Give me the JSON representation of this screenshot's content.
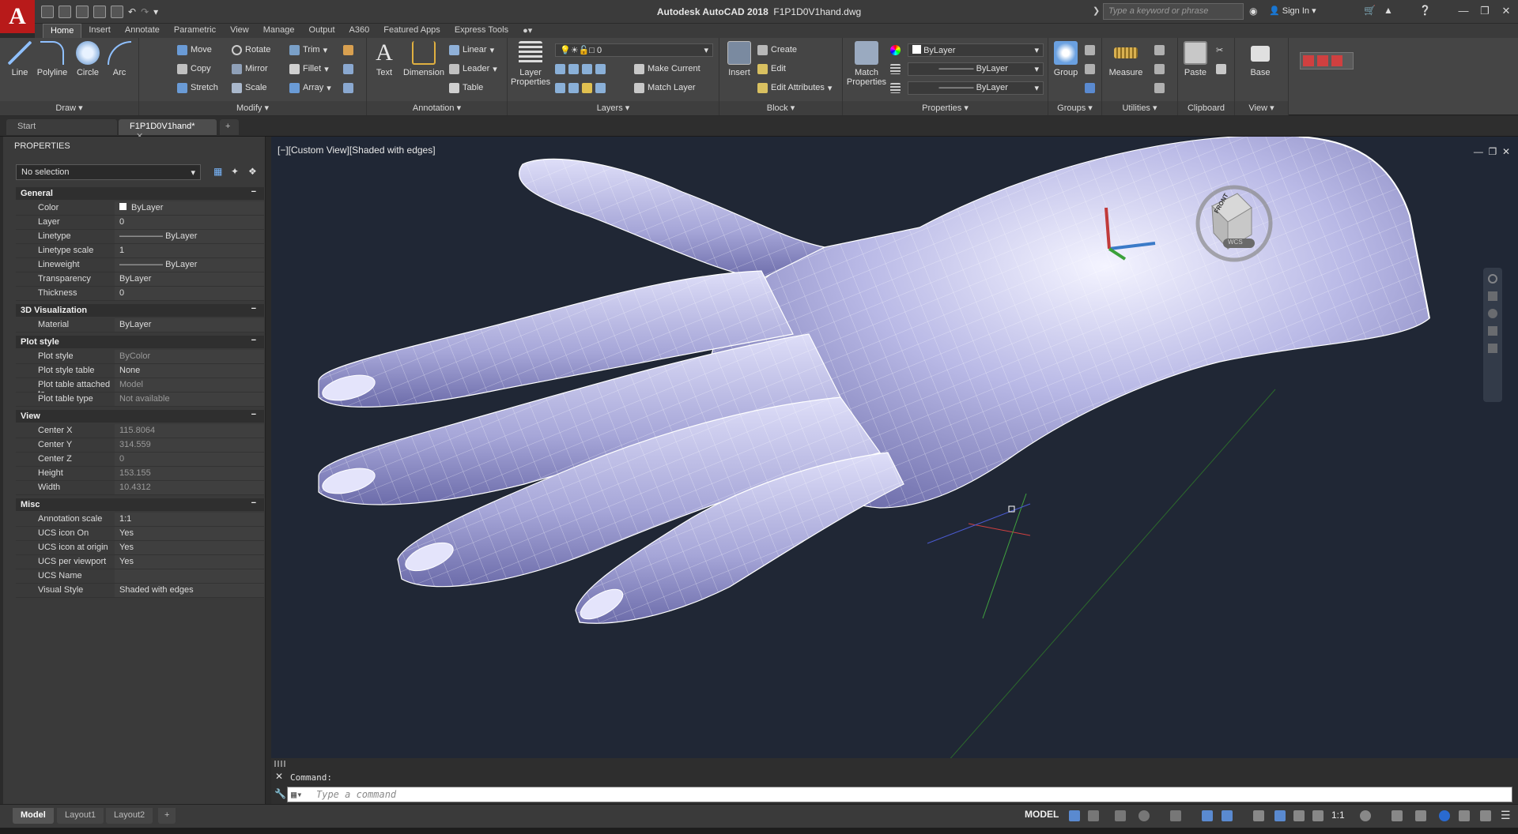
{
  "app": {
    "title_app": "Autodesk AutoCAD 2018",
    "title_file": "F1P1D0V1hand.dwg",
    "search_placeholder": "Type a keyword or phrase",
    "sign_in": "Sign In",
    "logo_letter": "A"
  },
  "menu_tabs": [
    "Home",
    "Insert",
    "Annotate",
    "Parametric",
    "View",
    "Manage",
    "Output",
    "A360",
    "Featured Apps",
    "Express Tools"
  ],
  "ribbon": {
    "draw": {
      "label": "Draw",
      "line": "Line",
      "polyline": "Polyline",
      "circle": "Circle",
      "arc": "Arc"
    },
    "modify": {
      "label": "Modify",
      "move": "Move",
      "rotate": "Rotate",
      "trim": "Trim",
      "copy": "Copy",
      "mirror": "Mirror",
      "fillet": "Fillet",
      "stretch": "Stretch",
      "scale": "Scale",
      "array": "Array"
    },
    "annotation": {
      "label": "Annotation",
      "text": "Text",
      "dimension": "Dimension",
      "linear": "Linear",
      "leader": "Leader",
      "table": "Table"
    },
    "layers": {
      "label": "Layers",
      "layer_properties": "Layer Properties",
      "current_layer": "0",
      "make_current": "Make Current",
      "match_layer": "Match Layer"
    },
    "block": {
      "label": "Block",
      "insert": "Insert",
      "create": "Create",
      "edit": "Edit",
      "edit_attributes": "Edit Attributes"
    },
    "properties": {
      "label": "Properties",
      "match_properties": "Match Properties",
      "color": "ByLayer",
      "linetype": "ByLayer",
      "lineweight": "ByLayer"
    },
    "groups": {
      "label": "Groups",
      "group": "Group"
    },
    "utilities": {
      "label": "Utilities",
      "measure": "Measure"
    },
    "clipboard": {
      "label": "Clipboard",
      "paste": "Paste"
    },
    "view": {
      "label": "View",
      "base": "Base"
    }
  },
  "doc_tabs": {
    "start": "Start",
    "active": "F1P1D0V1hand*"
  },
  "properties_palette": {
    "title": "PROPERTIES",
    "selection": "No selection",
    "sections": [
      {
        "name": "General",
        "rows": [
          {
            "key": "Color",
            "value": "ByLayer"
          },
          {
            "key": "Layer",
            "value": "0"
          },
          {
            "key": "Linetype",
            "value": "ByLayer"
          },
          {
            "key": "Linetype scale",
            "value": "1"
          },
          {
            "key": "Lineweight",
            "value": "ByLayer"
          },
          {
            "key": "Transparency",
            "value": "ByLayer"
          },
          {
            "key": "Thickness",
            "value": "0"
          }
        ]
      },
      {
        "name": "3D Visualization",
        "rows": [
          {
            "key": "Material",
            "value": "ByLayer"
          }
        ]
      },
      {
        "name": "Plot style",
        "rows": [
          {
            "key": "Plot style",
            "value": "ByColor"
          },
          {
            "key": "Plot style table",
            "value": "None"
          },
          {
            "key": "Plot table attached to",
            "value": "Model"
          },
          {
            "key": "Plot table type",
            "value": "Not available"
          }
        ]
      },
      {
        "name": "View",
        "rows": [
          {
            "key": "Center X",
            "value": "115.8064"
          },
          {
            "key": "Center Y",
            "value": "314.559"
          },
          {
            "key": "Center Z",
            "value": "0"
          },
          {
            "key": "Height",
            "value": "153.155"
          },
          {
            "key": "Width",
            "value": "10.4312"
          }
        ]
      },
      {
        "name": "Misc",
        "rows": [
          {
            "key": "Annotation scale",
            "value": "1:1"
          },
          {
            "key": "UCS icon On",
            "value": "Yes"
          },
          {
            "key": "UCS icon at origin",
            "value": "Yes"
          },
          {
            "key": "UCS per viewport",
            "value": "Yes"
          },
          {
            "key": "UCS Name",
            "value": ""
          },
          {
            "key": "Visual Style",
            "value": "Shaded with edges"
          }
        ]
      }
    ]
  },
  "viewport": {
    "label": "[−][Custom View][Shaded with edges]",
    "viewcube_face": "FRONT",
    "wcs": "WCS"
  },
  "command": {
    "history": "Command:",
    "placeholder": "Type a command"
  },
  "layout_tabs": [
    "Model",
    "Layout1",
    "Layout2"
  ],
  "status": {
    "model": "MODEL",
    "scale": "1:1"
  }
}
